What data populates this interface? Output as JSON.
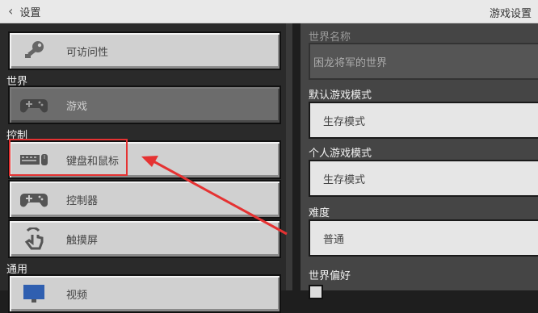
{
  "topbar": {
    "back_label": "设置",
    "heading": "游戏设置"
  },
  "sidebar": {
    "sections": {
      "world": "世界",
      "controls": "控制",
      "general": "通用"
    },
    "items": [
      {
        "label": "可访问性",
        "icon": "key-icon"
      },
      {
        "label": "游戏",
        "icon": "gamepad-icon",
        "selected": true
      },
      {
        "label": "键盘和鼠标",
        "icon": "keyboard-mouse-icon"
      },
      {
        "label": "控制器",
        "icon": "controller-icon"
      },
      {
        "label": "触摸屏",
        "icon": "touch-icon"
      },
      {
        "label": "视频",
        "icon": "monitor-icon"
      }
    ]
  },
  "settings": {
    "world_name_label": "世界名称",
    "world_name_value": "困龙将军的世界",
    "default_mode_label": "默认游戏模式",
    "default_mode_value": "生存模式",
    "personal_mode_label": "个人游戏模式",
    "personal_mode_value": "生存模式",
    "difficulty_label": "难度",
    "difficulty_value": "普通",
    "world_prefs_label": "世界偏好"
  },
  "colors": {
    "annotation": "#e53232"
  }
}
